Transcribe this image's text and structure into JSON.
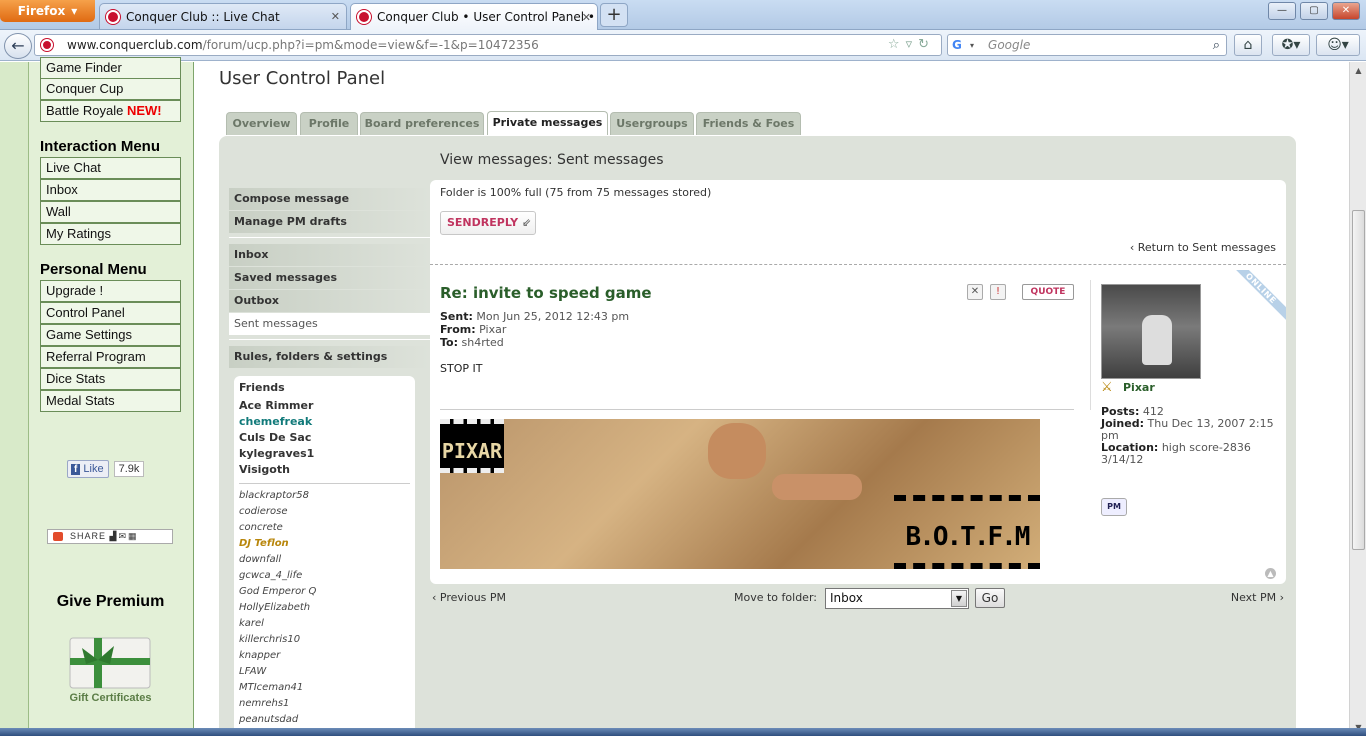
{
  "browser": {
    "firefox_label": "Firefox",
    "tabs": [
      {
        "label": "Conquer Club :: Live Chat",
        "active": false
      },
      {
        "label": "Conquer Club • User Control Panel • ...",
        "active": true
      }
    ],
    "new_tab": "+",
    "url_domain": "www.conquerclub.com",
    "url_path": "/forum/ucp.php?i=pm&mode=view&f=-1&p=10472356",
    "search_placeholder": "Google",
    "icons": [
      "back-arrow-icon",
      "bookmark-star-icon",
      "reload-icon",
      "google-icon",
      "search-icon",
      "home-icon",
      "bookmarks-icon",
      "addon-icon"
    ]
  },
  "sidebar": {
    "top_items": [
      "Game Finder",
      "Conquer Cup",
      "Battle Royale"
    ],
    "new_badge": "NEW!",
    "interaction_heading": "Interaction Menu",
    "interaction_items": [
      "Live Chat",
      "Inbox",
      "Wall",
      "My Ratings"
    ],
    "personal_heading": "Personal Menu",
    "personal_items": [
      "Upgrade !",
      "Control Panel",
      "Game Settings",
      "Referral Program",
      "Dice Stats",
      "Medal Stats"
    ],
    "fb_like": "Like",
    "fb_count": "7.9k",
    "share": "SHARE",
    "give_premium": "Give Premium",
    "gift_caption": "Gift Certificates"
  },
  "ucp": {
    "title": "User Control Panel",
    "tabs": [
      "Overview",
      "Profile",
      "Board preferences",
      "Private messages",
      "Usergroups",
      "Friends & Foes"
    ],
    "active_tab": "Private messages",
    "heading": "View messages: Sent messages",
    "pm_menu": {
      "group1": [
        "Compose message",
        "Manage PM drafts"
      ],
      "group2": [
        "Inbox",
        "Saved messages",
        "Outbox",
        "Sent messages"
      ],
      "group3": [
        "Rules, folders & settings"
      ],
      "active": "Sent messages"
    },
    "friends": {
      "title": "Friends",
      "online": [
        "Ace Rimmer",
        "chemefreak",
        "Culs De Sac",
        "kylegraves1",
        "Visigoth"
      ],
      "offline": [
        "blackraptor58",
        "codierose",
        "concrete",
        "DJ Teflon",
        "downfall",
        "gcwca_4_life",
        "God Emperor Q",
        "HollyElizabeth",
        "karel",
        "killerchris10",
        "knapper",
        "LFAW",
        "MTIceman41",
        "nemrehs1",
        "peanutsdad"
      ]
    }
  },
  "message": {
    "folder_status": "Folder is 100% full (75 from 75 messages stored)",
    "send_label": "SEND",
    "reply_label": "REPLY",
    "return_link": "Return to Sent messages",
    "subject": "Re: invite to speed game",
    "sent_label": "Sent:",
    "sent_value": "Mon Jun 25, 2012 12:43 pm",
    "from_label": "From:",
    "from_value": "Pixar",
    "to_label": "To:",
    "to_value": "sh4rted",
    "body": "STOP IT",
    "quote_label": "QUOTE",
    "online_label": "ONLINE",
    "signature_left": "PIXAR",
    "signature_right": "B.O.T.F.M",
    "poster": {
      "name": "Pixar",
      "posts_label": "Posts:",
      "posts_value": "412",
      "joined_label": "Joined:",
      "joined_value": "Thu Dec 13, 2007 2:15 pm",
      "location_label": "Location:",
      "location_value": "high score-2836 3/14/12",
      "pm_label": "PM"
    }
  },
  "pagination": {
    "prev": "Previous PM",
    "next": "Next PM",
    "move_label": "Move to folder:",
    "folder_selected": "Inbox",
    "go": "Go"
  }
}
